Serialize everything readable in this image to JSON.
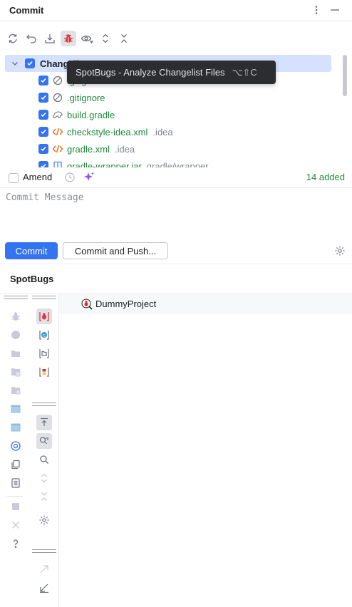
{
  "header": {
    "title": "Commit"
  },
  "tree": {
    "rows": [
      {
        "label": "Changelist",
        "sub": ""
      },
      {
        "label": ".gitignore",
        "sub": ""
      },
      {
        "label": ".gitignore",
        "sub": ""
      },
      {
        "label": "build.gradle",
        "sub": ""
      },
      {
        "label": "checkstyle-idea.xml",
        "sub": ".idea"
      },
      {
        "label": "gradle.xml",
        "sub": ".idea"
      },
      {
        "label": "gradle-wrapper.jar",
        "sub": "gradle/wrapper"
      }
    ]
  },
  "tooltip": {
    "text": "SpotBugs - Analyze Changelist Files",
    "shortcut": "⌥⇧C"
  },
  "amend": {
    "label": "Amend",
    "added": "14 added"
  },
  "commit": {
    "placeholder": "Commit Message",
    "commit_label": "Commit",
    "push_label": "Commit and Push..."
  },
  "spotbugs": {
    "title": "SpotBugs",
    "result_label": "DummyProject"
  },
  "colors": {
    "accent": "#3574f0",
    "added": "#208a3c",
    "bug": "#d9363e"
  }
}
